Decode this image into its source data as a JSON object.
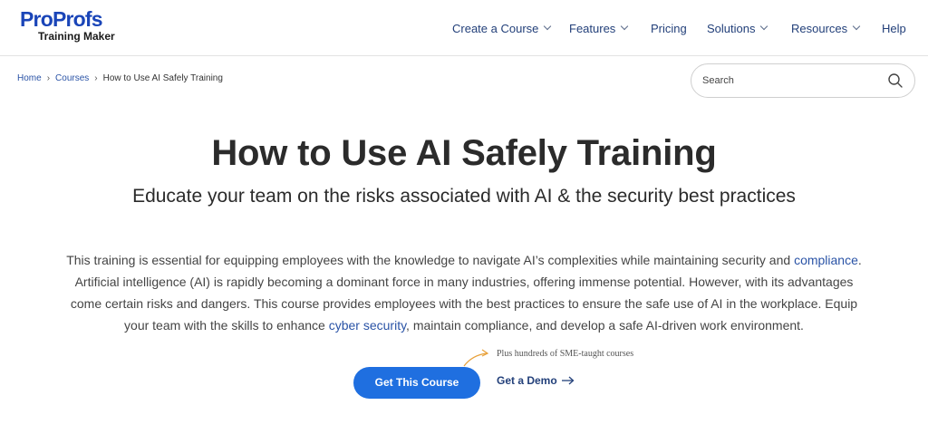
{
  "brand": {
    "logo_main_part1": "Pro",
    "logo_main_part2": "Profs",
    "logo_sub": "Training Maker",
    "color": "#1a45b8"
  },
  "nav": {
    "items": [
      {
        "label": "Create a Course",
        "has_dropdown": true
      },
      {
        "label": "Features",
        "has_dropdown": true
      },
      {
        "label": "Pricing",
        "has_dropdown": false
      },
      {
        "label": "Solutions",
        "has_dropdown": true
      },
      {
        "label": "Resources",
        "has_dropdown": true
      },
      {
        "label": "Help",
        "has_dropdown": false
      }
    ]
  },
  "breadcrumb": {
    "items": [
      "Home",
      "Courses",
      "How to Use AI Safely Training"
    ]
  },
  "search": {
    "placeholder": "Search",
    "value": "",
    "icon": "search-icon"
  },
  "hero": {
    "title": "How to Use AI Safely Training",
    "subtitle": "Educate your team on the risks associated with AI & the security best practices",
    "para_1": "This training is essential for equipping employees with the knowledge to navigate AI’s complexities while maintaining security and ",
    "link_compliance": "compliance",
    "para_2": ". Artificial intelligence (AI) is rapidly becoming a dominant force in many industries, offering immense potential. However, with its advantages come certain risks and dangers. This course provides employees with the best practices to ensure the safe use of AI in the workplace. Equip your team with the skills to enhance ",
    "link_cyber": "cyber security",
    "para_3": ", maintain compliance, and develop a safe AI-driven work environment.",
    "link_color": "#2a53a6"
  },
  "cta": {
    "note": "Plus hundreds of SME-taught courses",
    "primary_label": "Get This Course",
    "primary_color": "#1f6fe0",
    "secondary_label": "Get a Demo",
    "arrow_color": "#e8a13a"
  }
}
